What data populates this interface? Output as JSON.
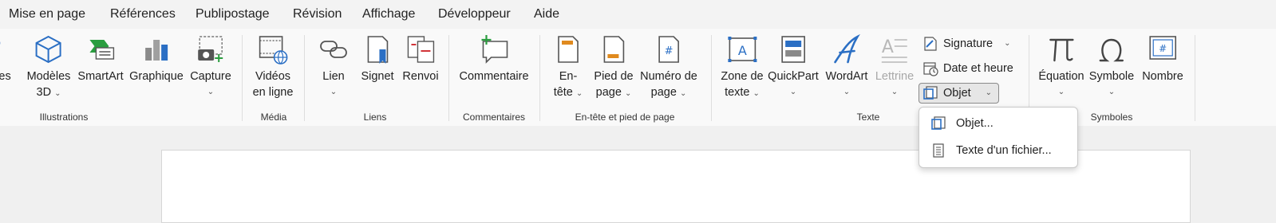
{
  "menu": {
    "items": [
      "Mise en page",
      "Références",
      "Publipostage",
      "Révision",
      "Affichage",
      "Développeur",
      "Aide"
    ]
  },
  "ribbon": {
    "illustrations": {
      "label": "Illustrations",
      "icones_partial": "ones",
      "modeles_3d": [
        "Modèles",
        "3D"
      ],
      "smartart": "SmartArt",
      "graphique": "Graphique",
      "capture": "Capture"
    },
    "media": {
      "label": "Média",
      "videos": [
        "Vidéos",
        "en ligne"
      ]
    },
    "liens": {
      "label": "Liens",
      "lien": "Lien",
      "signet": "Signet",
      "renvoi": "Renvoi"
    },
    "commentaires": {
      "label": "Commentaires",
      "commentaire": "Commentaire"
    },
    "entete": {
      "label": "En-tête et pied de page",
      "entete": [
        "En-",
        "tête"
      ],
      "pied": [
        "Pied de",
        "page"
      ],
      "numero": [
        "Numéro de",
        "page"
      ]
    },
    "texte": {
      "label": "Texte",
      "zone": [
        "Zone de",
        "texte"
      ],
      "quickpart": "QuickPart",
      "wordart": "WordArt",
      "lettrine": "Lettrine",
      "signature": "Signature",
      "date_heure": "Date et heure",
      "objet": "Objet"
    },
    "symboles": {
      "label": "Symboles",
      "equation": "Équation",
      "symbole": "Symbole",
      "nombre": "Nombre"
    }
  },
  "dropdown": {
    "items": [
      "Objet...",
      "Texte d'un fichier..."
    ]
  },
  "colors": {
    "accent": "#2b6fc4",
    "green": "#2a9d3f",
    "orange": "#e08a1e",
    "red": "#d13438"
  }
}
